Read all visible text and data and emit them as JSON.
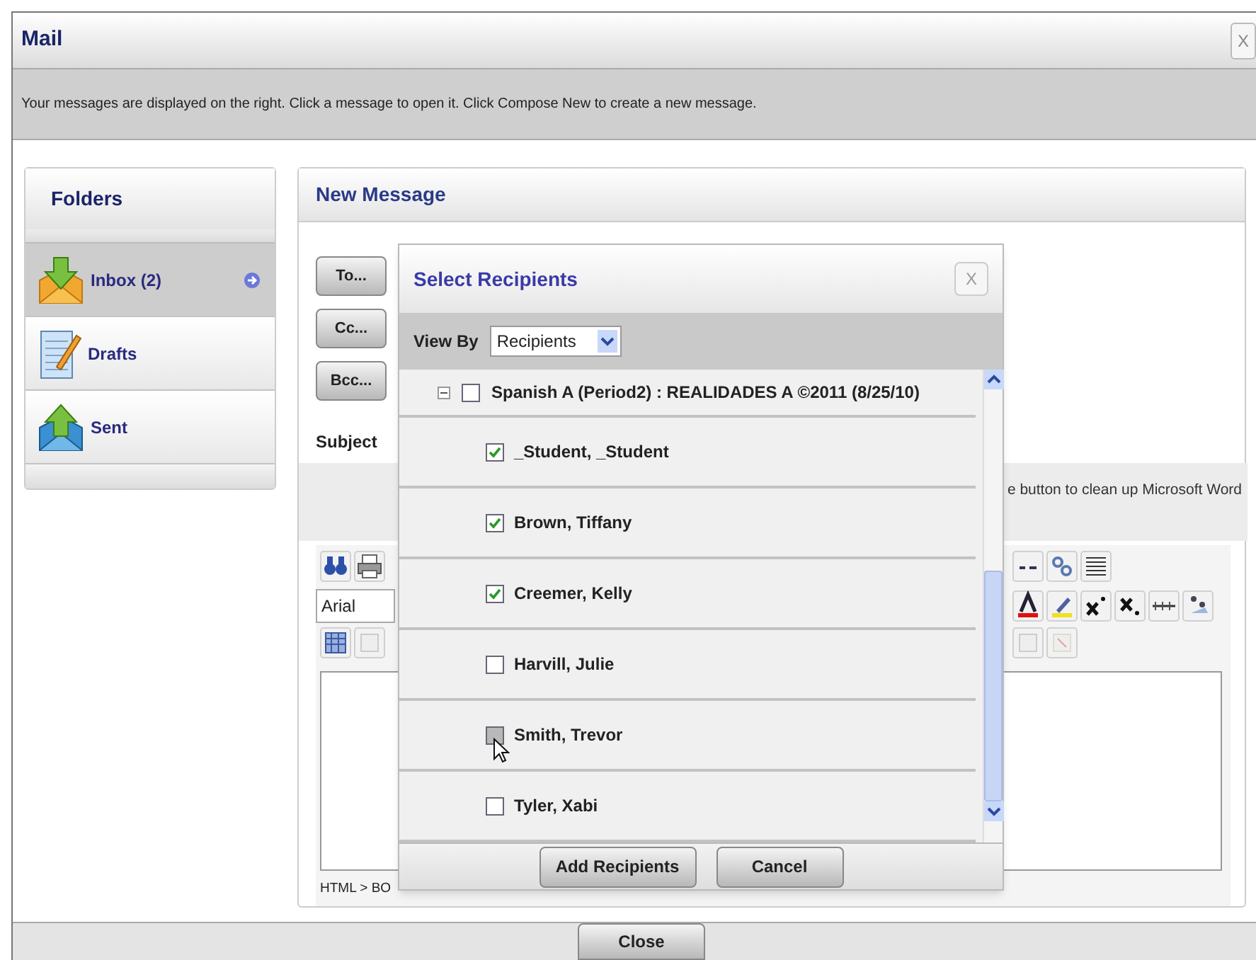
{
  "window": {
    "title": "Mail",
    "close": "X"
  },
  "info_text": "Your messages are displayed on the right. Click a message to open it. Click Compose New to create a new message.",
  "folders": {
    "title": "Folders",
    "items": [
      {
        "label": "Inbox (2)",
        "kind": "inbox",
        "selected": true
      },
      {
        "label": "Drafts",
        "kind": "drafts",
        "selected": false
      },
      {
        "label": "Sent",
        "kind": "sent",
        "selected": false
      }
    ]
  },
  "new_message": {
    "title": "New Message",
    "address_buttons": [
      "To...",
      "Cc...",
      "Bcc..."
    ],
    "subject_label": "Subject",
    "hint_fragment": "e button to clean up Microsoft Word",
    "font_field": {
      "value": "Arial"
    },
    "status_path": "HTML > BO"
  },
  "dialog": {
    "title": "Select Recipients",
    "close": "X",
    "view_by_label": "View By",
    "view_by_value": "Recipients",
    "group": {
      "label": "Spanish A (Period2) : REALIDADES A ©2011 (8/25/10)",
      "expanded": true,
      "checked": false,
      "children": [
        {
          "label": "_Student, _Student",
          "checked": true,
          "hovered": false
        },
        {
          "label": "Brown, Tiffany",
          "checked": true,
          "hovered": false
        },
        {
          "label": "Creemer, Kelly",
          "checked": true,
          "hovered": false
        },
        {
          "label": "Harvill, Julie",
          "checked": false,
          "hovered": false
        },
        {
          "label": "Smith, Trevor",
          "checked": false,
          "hovered": true
        },
        {
          "label": "Tyler, Xabi",
          "checked": false,
          "hovered": false
        }
      ]
    },
    "buttons": [
      "Add Recipients",
      "Cancel"
    ]
  },
  "close_button": "Close"
}
